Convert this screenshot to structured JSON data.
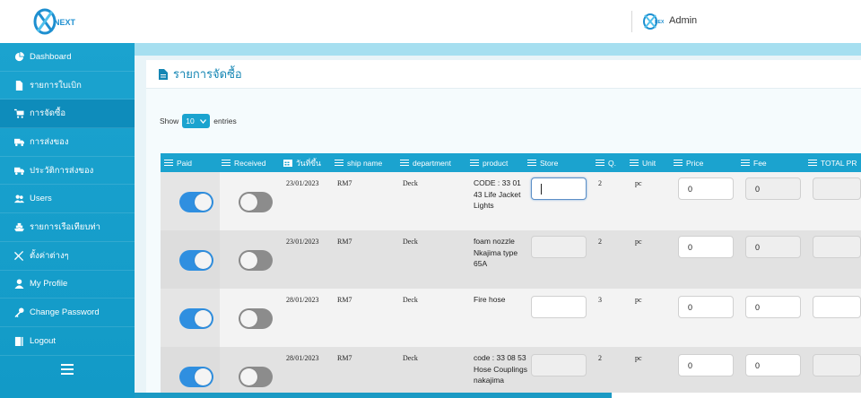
{
  "header": {
    "logo_text": "NEXT",
    "user_name": "Admin"
  },
  "sidebar": {
    "items": [
      {
        "label": "Dashboard",
        "icon": "pie-chart-icon",
        "active": false
      },
      {
        "label": "รายการใบเบิก",
        "icon": "file-icon",
        "active": false
      },
      {
        "label": "การจัดซื้อ",
        "icon": "cart-icon",
        "active": true
      },
      {
        "label": "การส่งของ",
        "icon": "truck-icon",
        "active": false
      },
      {
        "label": "ประวัติการส่งของ",
        "icon": "truck-icon",
        "active": false
      },
      {
        "label": "Users",
        "icon": "users-icon",
        "active": false
      },
      {
        "label": "รายการเรือเทียบท่า",
        "icon": "ship-icon",
        "active": false
      },
      {
        "label": "ตั้งค่าต่างๆ",
        "icon": "tools-icon",
        "active": false
      },
      {
        "label": "My Profile",
        "icon": "user-icon",
        "active": false
      },
      {
        "label": "Change Password",
        "icon": "key-icon",
        "active": false
      },
      {
        "label": "Logout",
        "icon": "logout-icon",
        "active": false
      }
    ]
  },
  "page": {
    "title": "รายการจัดซื้อ",
    "show_label": "Show",
    "entries_value": "10",
    "entries_label": "entries"
  },
  "table": {
    "columns": [
      "Paid",
      "Received",
      "วันที่ขึ้น",
      "ship name",
      "department",
      "product",
      "Store",
      "Q.",
      "Unit",
      "Price",
      "Fee",
      "TOTAL PR"
    ],
    "rows": [
      {
        "paid": true,
        "received": false,
        "date": "23/01/2023",
        "ship": "RM7",
        "dept": "Deck",
        "product": "CODE : 33 01 43 Life Jacket Lights",
        "store": "",
        "qty": "2",
        "unit": "pc",
        "price": "0",
        "fee": "0",
        "total": ""
      },
      {
        "paid": true,
        "received": false,
        "date": "23/01/2023",
        "ship": "RM7",
        "dept": "Deck",
        "product": "foam nozzle Nkajima type 65A",
        "store": "",
        "qty": "2",
        "unit": "pc",
        "price": "0",
        "fee": "0",
        "total": ""
      },
      {
        "paid": true,
        "received": false,
        "date": "28/01/2023",
        "ship": "RM7",
        "dept": "Deck",
        "product": "Fire hose",
        "store": "",
        "qty": "3",
        "unit": "pc",
        "price": "0",
        "fee": "0",
        "total": ""
      },
      {
        "paid": true,
        "received": false,
        "date": "28/01/2023",
        "ship": "RM7",
        "dept": "Deck",
        "product": "code : 33 08 53 Hose Couplings nakajima",
        "store": "",
        "qty": "2",
        "unit": "pc",
        "price": "0",
        "fee": "0",
        "total": ""
      }
    ]
  },
  "colors": {
    "accent": "#1ba3cf",
    "toggle_on": "#2f8fe0",
    "toggle_off": "#8c8c8c"
  }
}
